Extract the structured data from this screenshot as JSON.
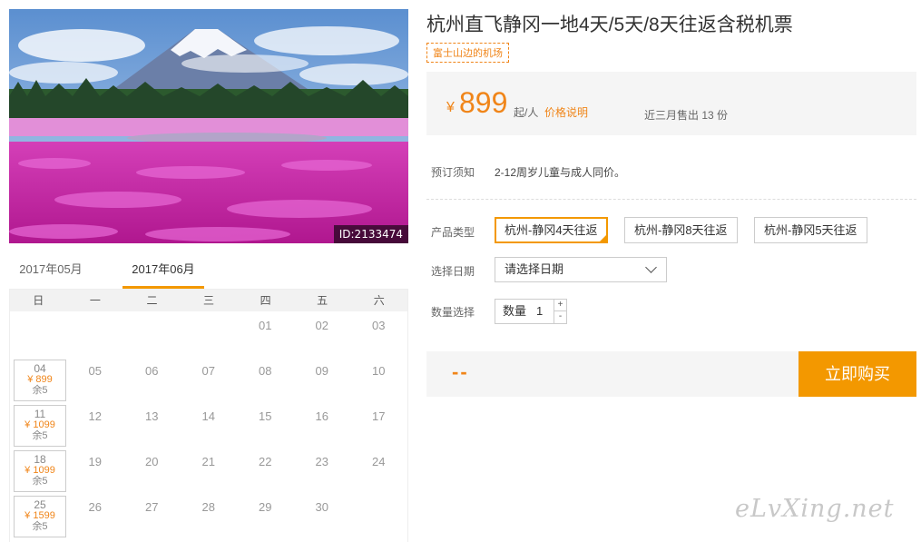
{
  "photo": {
    "id_label": "ID:2133474"
  },
  "calendar": {
    "tabs": [
      "2017年05月",
      "2017年06月"
    ],
    "active_tab": 1,
    "weekdays": [
      "日",
      "一",
      "二",
      "三",
      "四",
      "五",
      "六"
    ],
    "weeks": [
      [
        null,
        null,
        null,
        null,
        {
          "d": "01"
        },
        {
          "d": "02"
        },
        {
          "d": "03"
        }
      ],
      [
        {
          "d": "04",
          "price": "¥ 899",
          "remain": "余5"
        },
        {
          "d": "05"
        },
        {
          "d": "06"
        },
        {
          "d": "07"
        },
        {
          "d": "08"
        },
        {
          "d": "09"
        },
        {
          "d": "10"
        }
      ],
      [
        {
          "d": "11",
          "price": "¥ 1099",
          "remain": "余5"
        },
        {
          "d": "12"
        },
        {
          "d": "13"
        },
        {
          "d": "14"
        },
        {
          "d": "15"
        },
        {
          "d": "16"
        },
        {
          "d": "17"
        }
      ],
      [
        {
          "d": "18",
          "price": "¥ 1099",
          "remain": "余5"
        },
        {
          "d": "19"
        },
        {
          "d": "20"
        },
        {
          "d": "21"
        },
        {
          "d": "22"
        },
        {
          "d": "23"
        },
        {
          "d": "24"
        }
      ],
      [
        {
          "d": "25",
          "price": "¥ 1599",
          "remain": "余5"
        },
        {
          "d": "26"
        },
        {
          "d": "27"
        },
        {
          "d": "28"
        },
        {
          "d": "29"
        },
        {
          "d": "30"
        },
        null
      ]
    ]
  },
  "product": {
    "title": "杭州直飞静冈一地4天/5天/8天往返含税机票",
    "tag": "富士山边的机场",
    "price": {
      "currency": "¥",
      "amount": "899",
      "unit": "起/人",
      "note_link": "价格说明",
      "sold": "近三月售出 13 份"
    },
    "notice": {
      "label": "预订须知",
      "text": "2-12周岁儿童与成人同价。"
    },
    "type": {
      "label": "产品类型",
      "options": [
        "杭州-静冈4天往返",
        "杭州-静冈8天往返",
        "杭州-静冈5天往返"
      ],
      "selected": 0
    },
    "date": {
      "label": "选择日期",
      "value": "请选择日期"
    },
    "quantity": {
      "label": "数量选择",
      "field_label": "数量",
      "value": "1",
      "plus": "+",
      "minus": "-"
    },
    "total": "--",
    "buy": "立即购买"
  },
  "colors": {
    "accent": "#f39800",
    "price": "#f08519"
  },
  "watermark": "eLvXing.net"
}
